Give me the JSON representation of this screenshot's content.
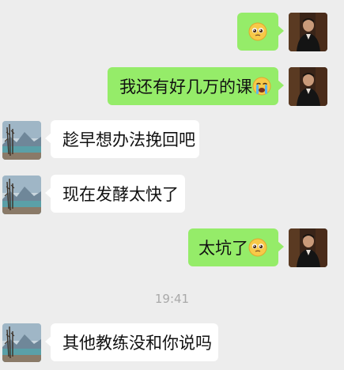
{
  "messages": [
    {
      "sender": "me",
      "text": "",
      "emoji": "pleading-face-emoji"
    },
    {
      "sender": "me",
      "text": "我还有好几万的课",
      "emoji": "crying-face-emoji"
    },
    {
      "sender": "other",
      "text": "趁早想办法挽回吧"
    },
    {
      "sender": "other",
      "text": "现在发酵太快了"
    },
    {
      "sender": "me",
      "text": "太坑了",
      "emoji": "pleading-face-emoji"
    },
    {
      "sender": "other",
      "text": "其他教练没和你说吗"
    }
  ],
  "timestamp": "19:41",
  "avatars": {
    "me": "man-in-dark-suit-avatar",
    "other": "mountain-landscape-avatar"
  },
  "colors": {
    "background": "#ededed",
    "my_bubble": "#95ec69",
    "other_bubble": "#ffffff",
    "timestamp": "#a9a9a9"
  }
}
